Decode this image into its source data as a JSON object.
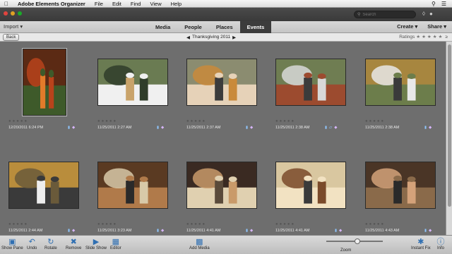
{
  "menubar": {
    "apple": "",
    "app_name": "Adobe Elements Organizer",
    "items": [
      "File",
      "Edit",
      "Find",
      "View",
      "Help"
    ]
  },
  "search": {
    "placeholder": "Search"
  },
  "nav": {
    "import_label": "Import",
    "tabs": [
      "Media",
      "People",
      "Places",
      "Events"
    ],
    "active_tab": "Events",
    "create_label": "Create",
    "share_label": "Share"
  },
  "breadcrumb": {
    "back_label": "Back",
    "event_name": "Thanksgiving 2011",
    "ratings_label": "Ratings"
  },
  "photos": [
    {
      "date": "12/20/2011 6:24 PM",
      "scene": "leaves",
      "shape": "portrait",
      "badges": 2
    },
    {
      "date": "11/25/2011 2:27 AM",
      "scene": "group",
      "shape": "landscape",
      "badges": 2
    },
    {
      "date": "11/25/2011 2:37 AM",
      "scene": "couple",
      "shape": "landscape",
      "badges": 2
    },
    {
      "date": "11/25/2011 2:38 AM",
      "scene": "family",
      "shape": "landscape",
      "badges": 3
    },
    {
      "date": "11/25/2011 2:38 AM",
      "scene": "pair",
      "shape": "landscape",
      "badges": 2
    },
    {
      "date": "11/25/2011 2:44 AM",
      "scene": "tree",
      "shape": "landscape",
      "badges": 2
    },
    {
      "date": "11/25/2011 3:23 AM",
      "scene": "room",
      "shape": "landscape",
      "badges": 2
    },
    {
      "date": "11/25/2011 4:41 AM",
      "scene": "dinner",
      "shape": "landscape",
      "badges": 2
    },
    {
      "date": "11/25/2011 4:41 AM",
      "scene": "table",
      "shape": "landscape",
      "badges": 2
    },
    {
      "date": "11/25/2011 4:43 AM",
      "scene": "women",
      "shape": "landscape",
      "badges": 2
    }
  ],
  "toolbar": {
    "show_pane": "Show Pane",
    "undo": "Undo",
    "rotate": "Rotate",
    "remove": "Remove",
    "slide_show": "Slide Show",
    "editor": "Editor",
    "add_media": "Add Media",
    "zoom": "Zoom",
    "instant_fix": "Instant Fix",
    "info": "Info"
  },
  "colors": {
    "active_tab_bg": "#3c3c3c",
    "grid_bg": "#6e6e6e",
    "toolbar_icon": "#2f6fb2"
  }
}
